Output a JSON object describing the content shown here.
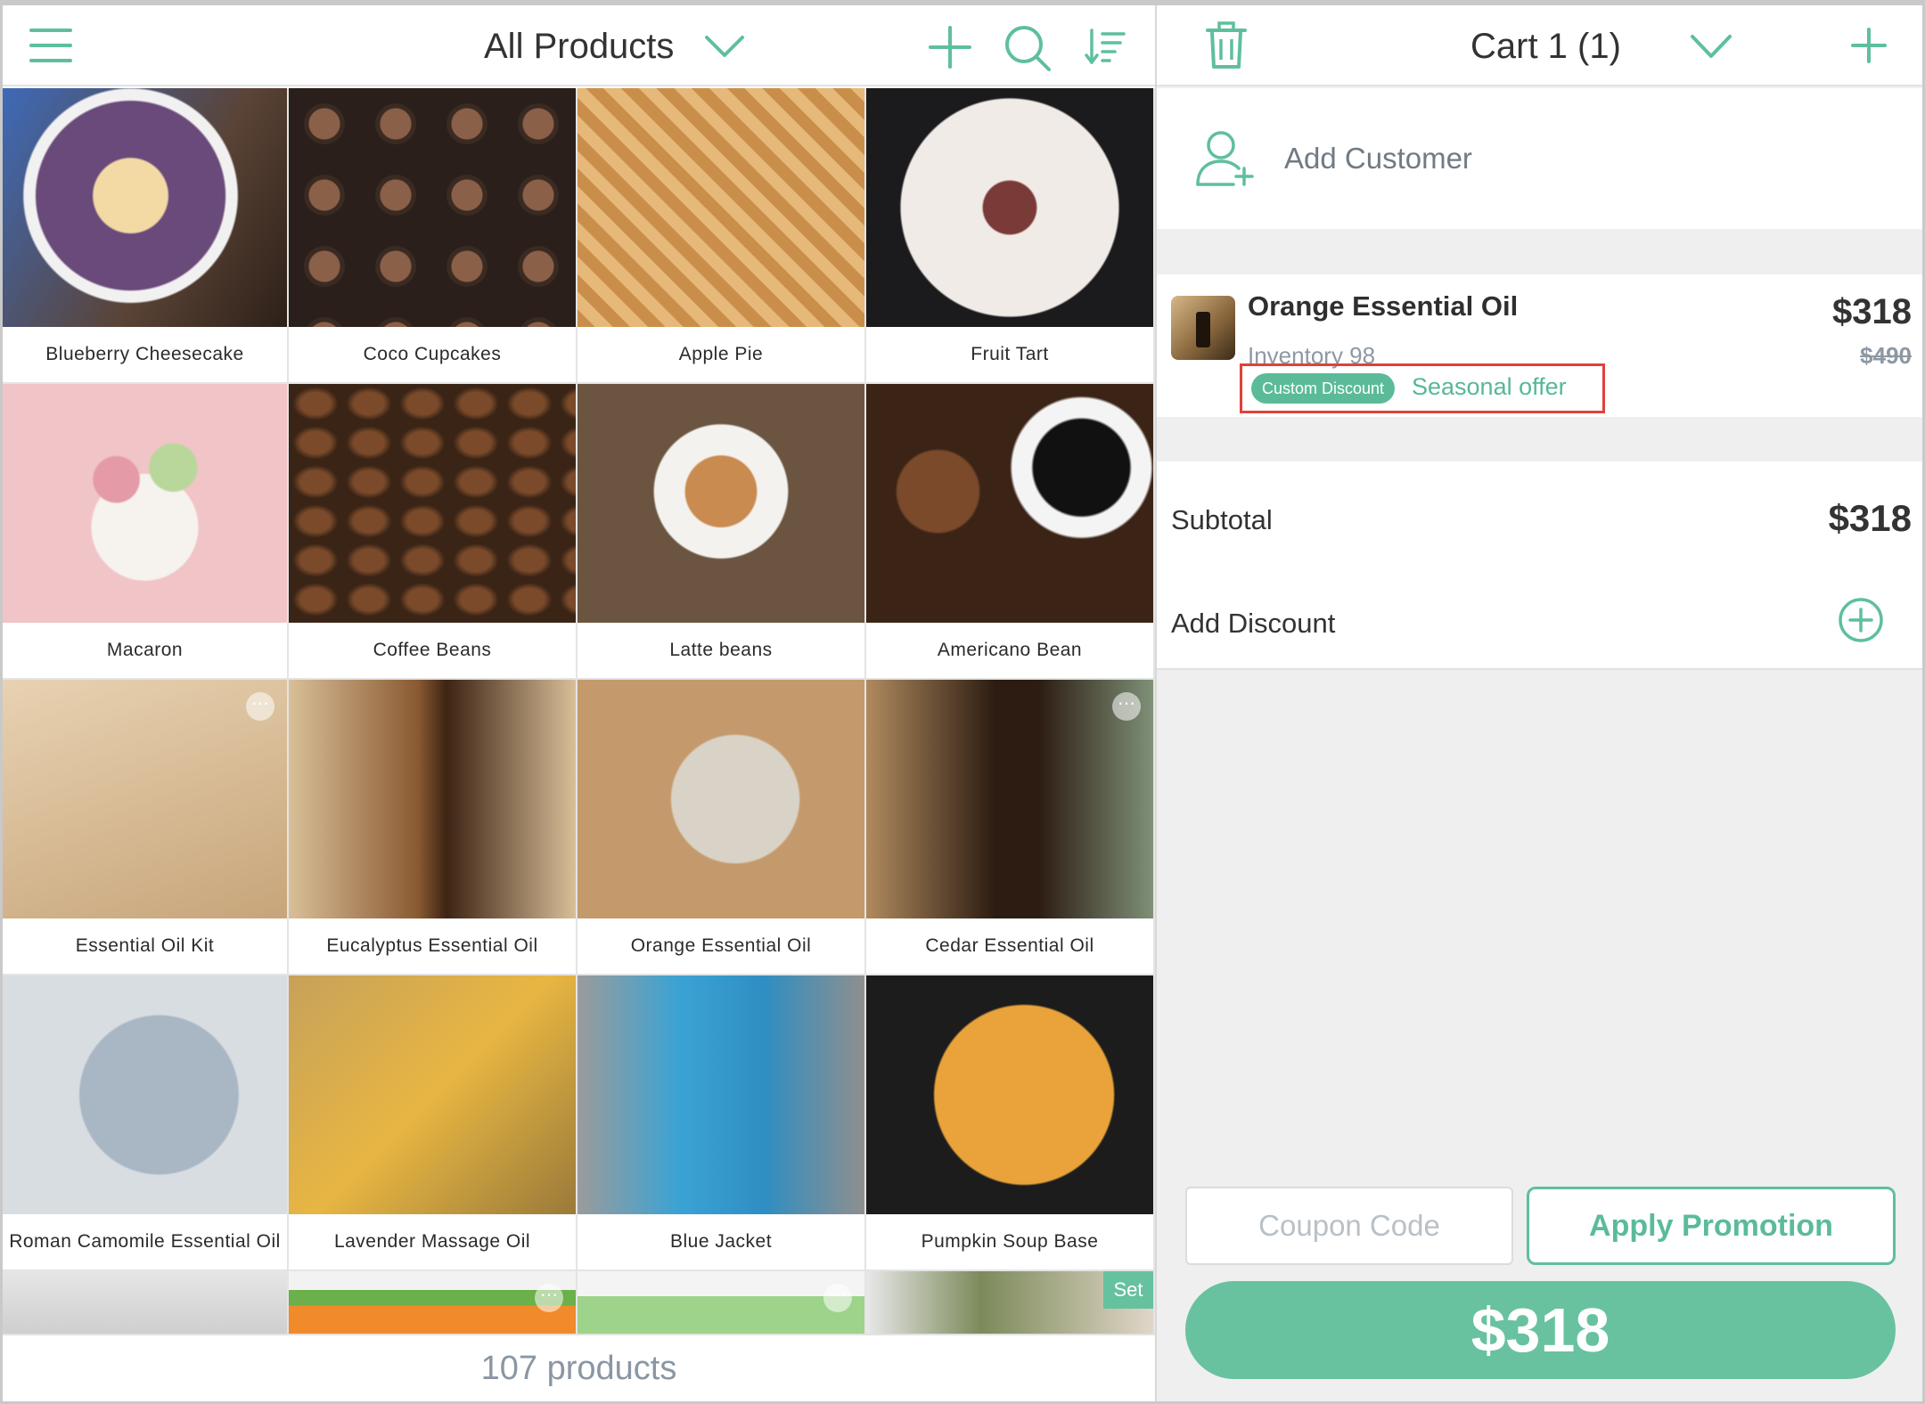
{
  "header": {
    "title": "All Products",
    "cart_title": "Cart 1 (1)"
  },
  "products": [
    {
      "name": "Blueberry Cheesecake"
    },
    {
      "name": "Coco Cupcakes"
    },
    {
      "name": "Apple Pie"
    },
    {
      "name": "Fruit Tart"
    },
    {
      "name": "Macaron"
    },
    {
      "name": "Coffee Beans"
    },
    {
      "name": "Latte beans"
    },
    {
      "name": "Americano Bean"
    },
    {
      "name": "Essential Oil Kit"
    },
    {
      "name": "Eucalyptus Essential Oil"
    },
    {
      "name": "Orange Essential Oil"
    },
    {
      "name": "Cedar Essential Oil"
    },
    {
      "name": "Roman Camomile Essential Oil"
    },
    {
      "name": "Lavender Massage Oil"
    },
    {
      "name": "Blue Jacket"
    },
    {
      "name": "Pumpkin Soup Base"
    }
  ],
  "partial_row": {
    "set_badge": "Set"
  },
  "footer": {
    "count": "107 products"
  },
  "cart": {
    "add_customer": "Add Customer",
    "item": {
      "name": "Orange Essential Oil",
      "inventory": "Inventory 98",
      "price": "$318",
      "original_price": "$490",
      "discount_badge": "Custom Discount",
      "discount_name": "Seasonal offer"
    },
    "subtotal_label": "Subtotal",
    "subtotal_value": "$318",
    "add_discount": "Add Discount",
    "coupon_placeholder": "Coupon Code",
    "apply_promotion": "Apply Promotion",
    "pay_total": "$318"
  },
  "colors": {
    "accent": "#5fbf9c",
    "highlight_box": "#e0413a"
  }
}
